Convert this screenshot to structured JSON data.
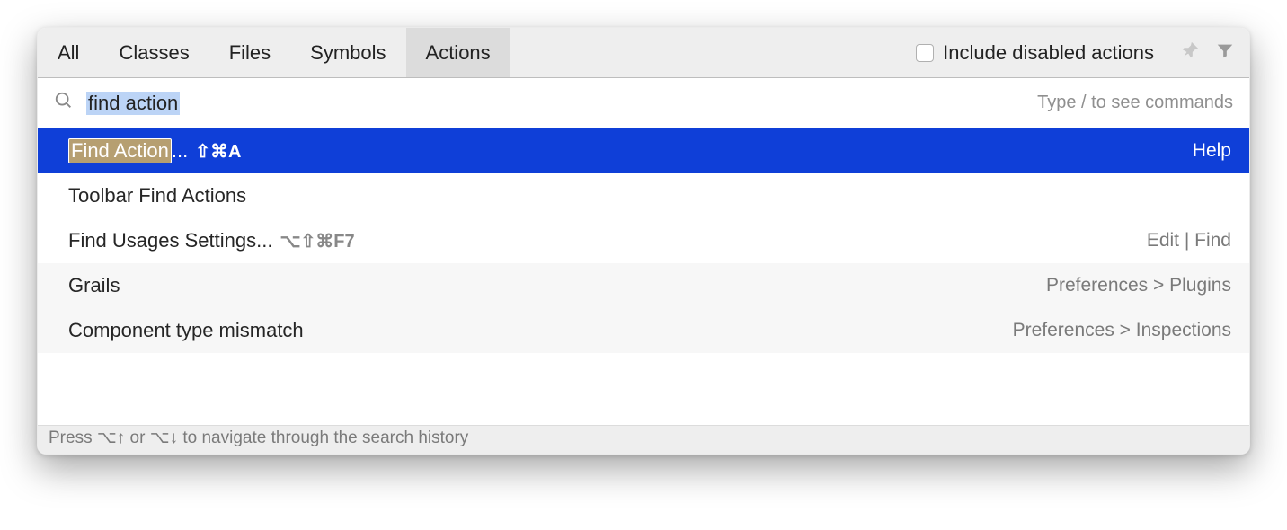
{
  "tabs": {
    "all": "All",
    "classes": "Classes",
    "files": "Files",
    "symbols": "Symbols",
    "actions": "Actions"
  },
  "include_label": "Include disabled actions",
  "search": {
    "value": "find action",
    "hint": "Type / to see commands"
  },
  "results": {
    "r0": {
      "title_hl": "Find Action",
      "title_suffix": "...",
      "shortcut": "⇧⌘A",
      "right": "Help"
    },
    "r1": {
      "title": "Toolbar Find Actions",
      "right": ""
    },
    "r2": {
      "title": "Find Usages Settings...",
      "shortcut": "⌥⇧⌘F7",
      "right": "Edit | Find"
    },
    "r3": {
      "title": "Grails",
      "right": "Preferences > Plugins"
    },
    "r4": {
      "title": "Component type mismatch",
      "right": "Preferences > Inspections"
    }
  },
  "footer": "Press ⌥↑ or ⌥↓ to navigate through the search history"
}
